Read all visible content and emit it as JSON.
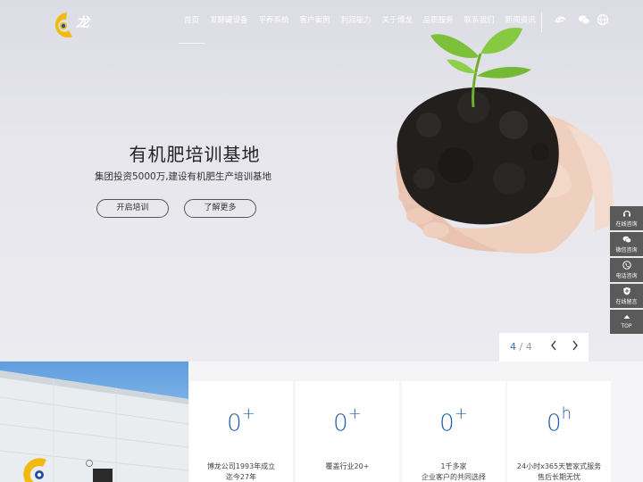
{
  "header": {
    "logo_text": "龙",
    "nav": [
      "首页",
      "发酵罐设备",
      "平养系统",
      "客户案例",
      "利润能力",
      "关于博龙",
      "品质服务",
      "联系我们",
      "新闻资讯"
    ],
    "icons": [
      "alibaba-icon",
      "wechat-icon",
      "globe-icon"
    ]
  },
  "hero": {
    "title": "有机肥培训基地",
    "subtitle": "集团投资5000万,建设有机肥生产培训基地",
    "btn_primary": "开启培训",
    "btn_secondary": "了解更多"
  },
  "slider": {
    "current": "4",
    "separator": "/",
    "total": "4"
  },
  "side": [
    {
      "label": "在线咨询",
      "icon": "headset-icon"
    },
    {
      "label": "微信咨询",
      "icon": "wechat-icon"
    },
    {
      "label": "电话咨询",
      "icon": "phone-icon"
    },
    {
      "label": "在线留言",
      "icon": "shield-icon"
    },
    {
      "label": "TOP",
      "icon": "arrow-up-icon"
    }
  ],
  "stats": [
    {
      "num": "0",
      "sup": "+",
      "line1": "博龙公司1993年成立",
      "line2": "迄今27年"
    },
    {
      "num": "0",
      "sup": "+",
      "line1": "覆盖行业20+",
      "line2": ""
    },
    {
      "num": "0",
      "sup": "+",
      "line1": "1千多家",
      "line2": "企业客户的共同选择"
    },
    {
      "num": "0",
      "sup": "h",
      "line1": "24小时x365天管家式服务",
      "line2": "售后长期无忧"
    }
  ],
  "colors": {
    "accent": "#1f5ea8",
    "logo_yellow": "#f2b90f",
    "side_bg": "#5a5a5a"
  }
}
